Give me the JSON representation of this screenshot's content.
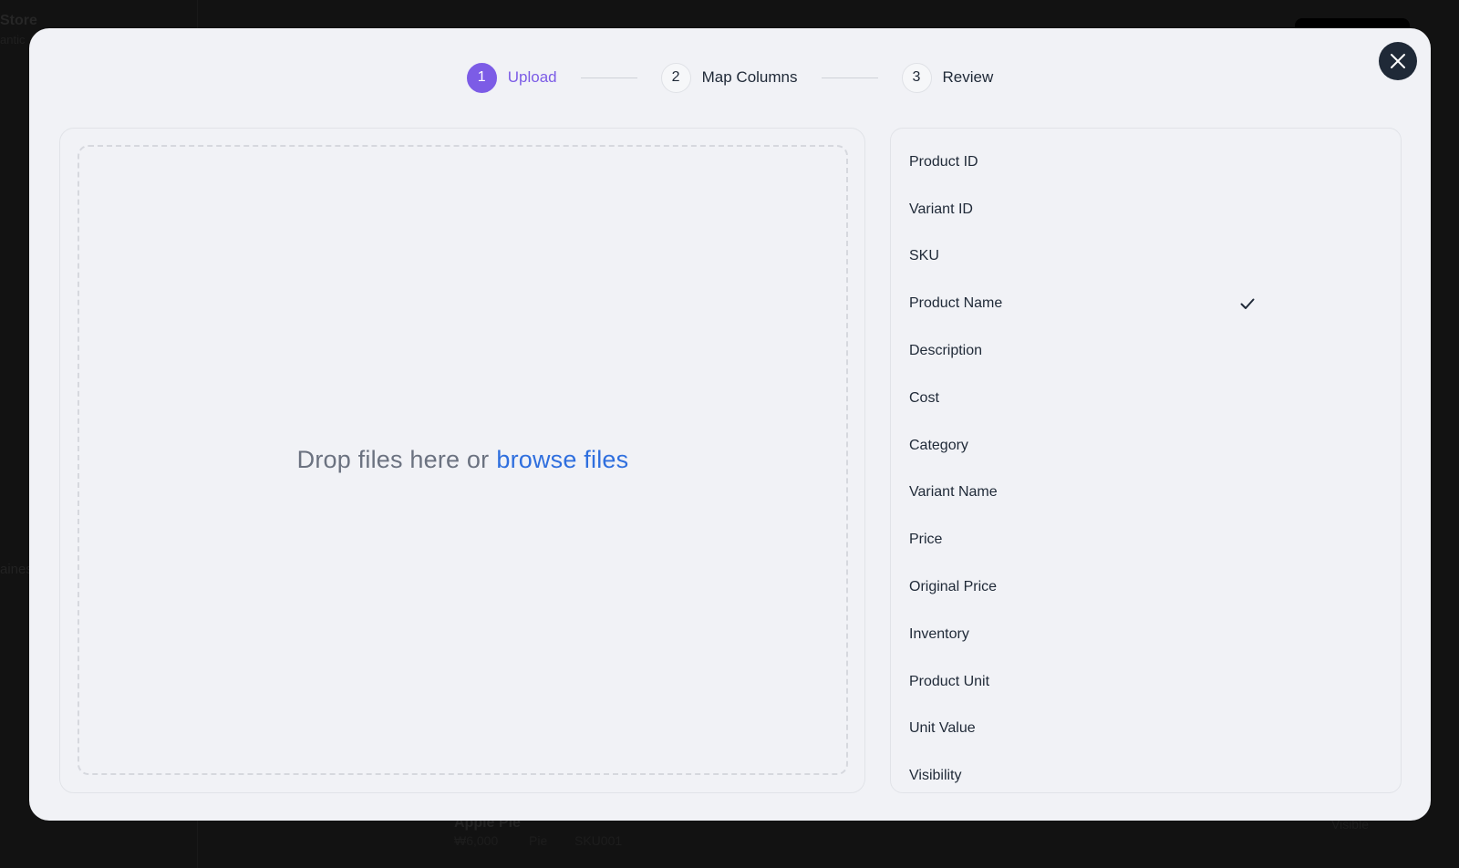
{
  "background": {
    "store_title": "Store",
    "store_subtitle": "antic",
    "side_label": "aines",
    "row": {
      "name": "Apple Pie",
      "price": "₩6,000",
      "unit": "Pie",
      "sku": "SKU001",
      "status": "Visible"
    }
  },
  "modal": {
    "close_label": "Close",
    "steps": [
      {
        "number": "1",
        "label": "Upload",
        "active": true
      },
      {
        "number": "2",
        "label": "Map Columns",
        "active": false
      },
      {
        "number": "3",
        "label": "Review",
        "active": false
      }
    ],
    "dropzone": {
      "text": "Drop files here or",
      "link": "browse files"
    },
    "columns": [
      {
        "label": "Product ID",
        "checked": false
      },
      {
        "label": "Variant ID",
        "checked": false
      },
      {
        "label": "SKU",
        "checked": false
      },
      {
        "label": "Product Name",
        "checked": true
      },
      {
        "label": "Description",
        "checked": false
      },
      {
        "label": "Cost",
        "checked": false
      },
      {
        "label": "Category",
        "checked": false
      },
      {
        "label": "Variant Name",
        "checked": false
      },
      {
        "label": "Price",
        "checked": false
      },
      {
        "label": "Original Price",
        "checked": false
      },
      {
        "label": "Inventory",
        "checked": false
      },
      {
        "label": "Product Unit",
        "checked": false
      },
      {
        "label": "Unit Value",
        "checked": false
      },
      {
        "label": "Visibility",
        "checked": false
      }
    ]
  },
  "colors": {
    "accent": "#7c5ce6",
    "link": "#2f6fde",
    "close_bg": "#1f2937",
    "modal_bg": "#f1f2f6"
  }
}
